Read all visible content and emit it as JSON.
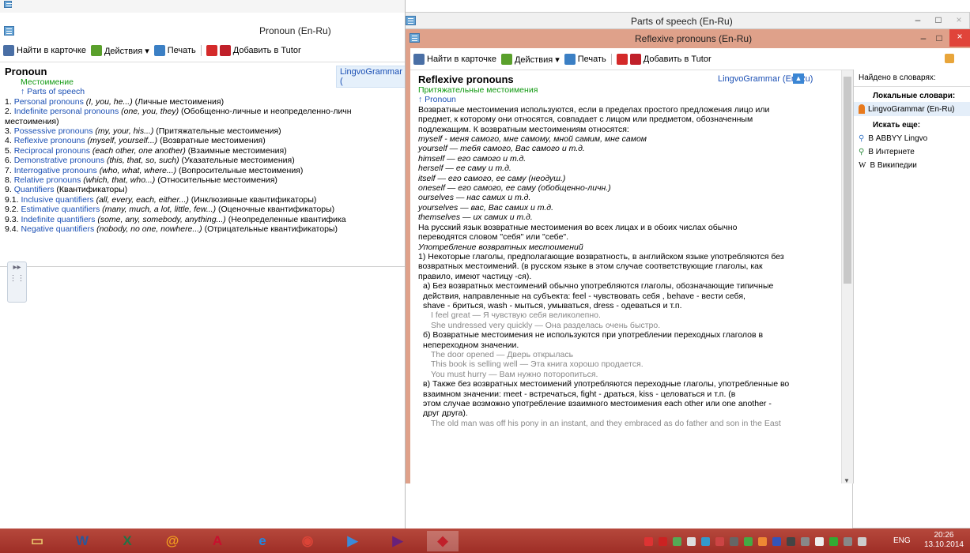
{
  "desktop": {
    "back_window_title": "Parts of speech (En-Ru)",
    "close_glyph": "×",
    "minimize_glyph": "–",
    "maximize_glyph": "□"
  },
  "pronoun_window": {
    "title": "Pronoun (En-Ru)",
    "toolbar": {
      "find": "Найти в карточке",
      "actions": "Действия ▾",
      "print": "Печать",
      "add_tutor": "Добавить в Tutor"
    },
    "badge": "LingvoGrammar (",
    "heading": "Pronoun",
    "subtitle": "Местоимение",
    "up_link": "↑ Parts of speech",
    "items": [
      {
        "num": "1. ",
        "link": "Personal pronouns",
        "ex": "(I, you, he...)",
        "ru": " (Личные местоимения)"
      },
      {
        "num": "2. ",
        "link": "Indefinite personal pronouns",
        "ex": "(one, you, they)",
        "ru": " (Обобщенно-личные и неопределенно-личн"
      },
      {
        "num": "",
        "link": "",
        "ex": "",
        "ru": "местоимения)"
      },
      {
        "num": "3. ",
        "link": "Possessive pronouns",
        "ex": "(my, your, his...)",
        "ru": " (Притяжательные местоимения)"
      },
      {
        "num": "4. ",
        "link": "Reflexive pronouns",
        "ex": "(myself, yourself...)",
        "ru": " (Возвратные местоимения)"
      },
      {
        "num": "5. ",
        "link": "Reciprocal pronouns",
        "ex": "(each other, one another)",
        "ru": " (Взаимные местоимения)"
      },
      {
        "num": "6. ",
        "link": "Demonstrative pronouns",
        "ex": "(this, that, so, such)",
        "ru": " (Указательные местоимения)"
      },
      {
        "num": "7. ",
        "link": "Interrogative pronouns",
        "ex": "(who, what, where...)",
        "ru": " (Вопросительные местоимения)"
      },
      {
        "num": "8. ",
        "link": "Relative pronouns",
        "ex": "(which, that, who...)",
        "ru": " (Относительные местоимения)"
      },
      {
        "num": "9. ",
        "link": "Quantifiers",
        "ex": "",
        "ru": " (Квантификаторы)"
      },
      {
        "num": "9.1. ",
        "link": "Inclusive quantifiers",
        "ex": "(all, every, each, either...)",
        "ru": " (Инклюзивные квантификаторы)"
      },
      {
        "num": "9.2. ",
        "link": "Estimative quantifiers",
        "ex": "(many, much, a lot, little, few...)",
        "ru": " (Оценочные квантификаторы)"
      },
      {
        "num": "9.3. ",
        "link": "Indefinite quantifiers",
        "ex": "(some, any, somebody, anything...)",
        "ru": " (Неопределенные квантифика"
      },
      {
        "num": "9.4. ",
        "link": "Negative quantifiers",
        "ex": "(nobody, no one, nowhere...)",
        "ru": " (Отрицательные квантификаторы)"
      }
    ]
  },
  "reflexive_window": {
    "title": "Reflexive pronouns (En-Ru)",
    "toolbar": {
      "find": "Найти в карточке",
      "actions": "Действия ▾",
      "print": "Печать",
      "add_tutor": "Добавить в Tutor"
    },
    "badge": "LingvoGrammar (En-Ru)",
    "heading": "Reflexive pronouns",
    "subtitle": "Притяжательные местоимения",
    "up_link": "↑ Pronoun",
    "lines": [
      {
        "t": "Возвратные местоимения используются, если в пределах простого предложения лицо или",
        "s": "n"
      },
      {
        "t": "предмет, к которому они относятся, совпадает с лицом или предметом, обозначенным",
        "s": "n"
      },
      {
        "t": "подлежащим. К возвратным местоимениям относятся:",
        "s": "n"
      },
      {
        "t": "myself - меня самого, мне самому, мной самим, мне самом",
        "s": "i"
      },
      {
        "t": "yourself — тебя самого, Вас самого и т.д.",
        "s": "i"
      },
      {
        "t": "himself — его самого и т.д.",
        "s": "i"
      },
      {
        "t": "herself — ее саму и т.д.",
        "s": "i"
      },
      {
        "t": "itself — его самого, ее саму (неодуш.)",
        "s": "i"
      },
      {
        "t": "oneself — его самого, ее саму (обобщенно-личн.)",
        "s": "i"
      },
      {
        "t": "ourselves — нас самих и т.д.",
        "s": "i"
      },
      {
        "t": "yourselves — вас, Вас самих и т.д.",
        "s": "i"
      },
      {
        "t": "themselves — их самих и т.д.",
        "s": "i"
      },
      {
        "t": "На русский язык возвратные местоимения во всех лицах и в обоих числах обычно",
        "s": "n"
      },
      {
        "t": "переводятся словом \"себя\" или \"себе\".",
        "s": "n"
      },
      {
        "t": "Употребление возвратных местоимений",
        "s": "i"
      },
      {
        "t": "1) Некоторые глаголы, предполагающие возвратность, в английском языке употребляются без",
        "s": "n"
      },
      {
        "t": "возвратных местоимений. (в русском языке в этом случае соответствующие глаголы, как",
        "s": "n"
      },
      {
        "t": "правило, имеют частицу -ся).",
        "s": "n"
      },
      {
        "t": "а) Без возвратных местоимений обычно употребляются глаголы, обозначающие типичные",
        "s": "n1"
      },
      {
        "t": "действия, направленные на субъекта: feel - чувствовать себя , behave - вести себя,",
        "s": "n1"
      },
      {
        "t": "shave - бриться, wash - мыться, умываться, dress - одеваться и т.п.",
        "s": "n1"
      },
      {
        "t": "I feel great — Я чувствую себя великолепно.",
        "s": "g"
      },
      {
        "t": "She undressed very quickly — Она разделась очень быстро.",
        "s": "g"
      },
      {
        "t": "б) Возвратные местоимения не используются при употреблении переходных глаголов в",
        "s": "n1"
      },
      {
        "t": "непереходном значении.",
        "s": "n1"
      },
      {
        "t": "The door opened — Дверь открылась",
        "s": "g"
      },
      {
        "t": "This book is selling well — Эта книга хорошо продается.",
        "s": "g"
      },
      {
        "t": "You must hurry — Вам нужно поторопиться.",
        "s": "g"
      },
      {
        "t": "в) Также без возвратных местоимений употребляются переходные глаголы, употребленные во",
        "s": "n1"
      },
      {
        "t": "взаимном значении: meet - встречаться, fight - драться, kiss - целоваться и т.п. (в",
        "s": "n1"
      },
      {
        "t": "этом случае возможно употребление взаимного местоимения each other или one another -",
        "s": "n1"
      },
      {
        "t": "друг друга).",
        "s": "n1"
      },
      {
        "t": "The old man was off his pony in an instant, and they embraced as do father and son in the East",
        "s": "g"
      }
    ]
  },
  "side_panel": {
    "found_in": "Найдено в словарях:",
    "local_dicts": "Локальные словари:",
    "dict_name": "LingvoGrammar (En-Ru)",
    "search_more": "Искать еще:",
    "search_items": [
      "В ABBYY Lingvo",
      "В Интернете",
      "В Википедии"
    ]
  },
  "taskbar": {
    "lang": "ENG",
    "time": "20:26",
    "date": "13.10.2014",
    "apps": [
      "file-explorer-icon",
      "word-icon",
      "excel-icon",
      "mail-agent-icon",
      "acrobat-icon",
      "internet-explorer-icon",
      "chrome-icon",
      "media-player-icon",
      "visual-studio-icon",
      "lingvo-icon"
    ]
  }
}
